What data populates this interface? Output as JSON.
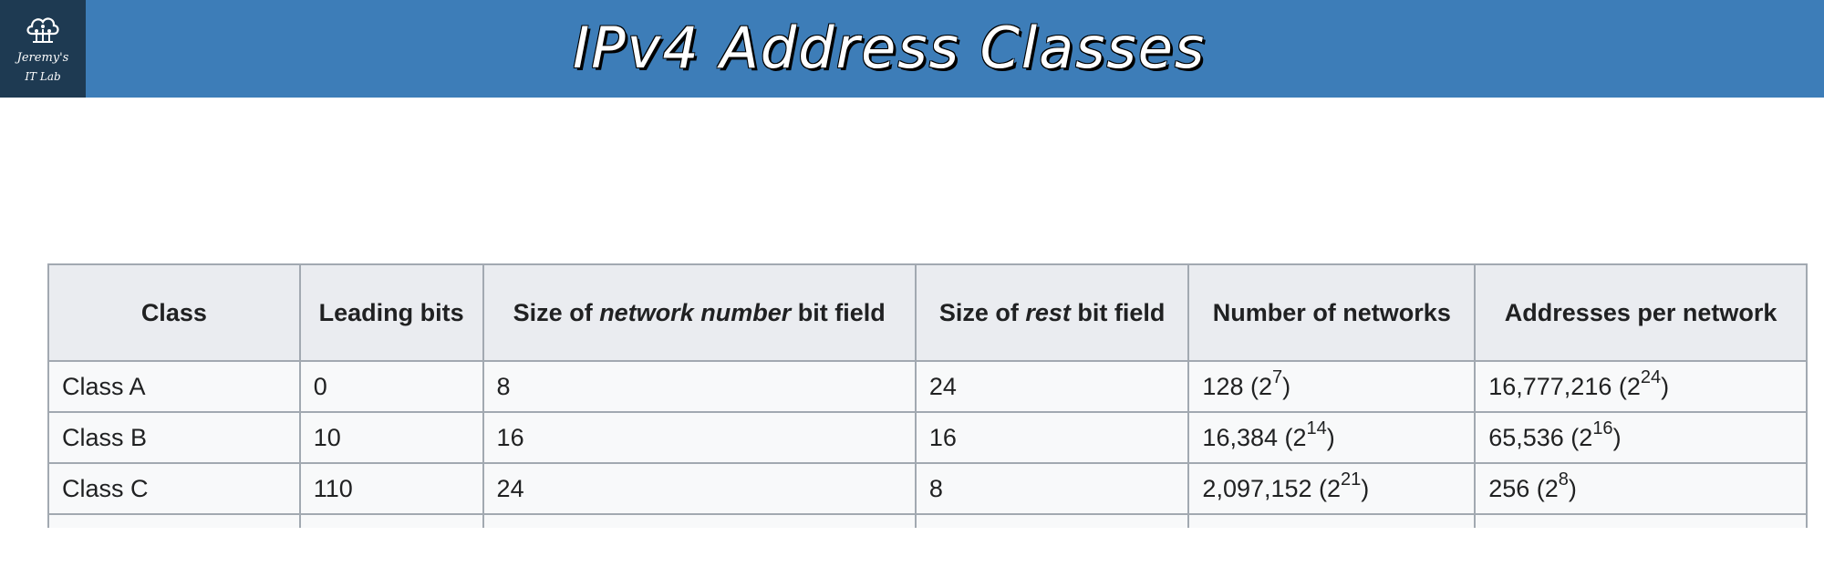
{
  "logo": {
    "line1": "Jeremy's",
    "line2": "IT Lab"
  },
  "title": "IPv4 Address Classes",
  "table": {
    "headers": [
      {
        "pre": "Class",
        "em": "",
        "post": ""
      },
      {
        "pre": "Leading bits",
        "em": "",
        "post": ""
      },
      {
        "pre": "Size of ",
        "em": "network number",
        "post": " bit field"
      },
      {
        "pre": "Size of ",
        "em": "rest",
        "post": " bit field"
      },
      {
        "pre": "Number of networks",
        "em": "",
        "post": ""
      },
      {
        "pre": "Addresses per network",
        "em": "",
        "post": ""
      }
    ],
    "rows": [
      {
        "class": "Class A",
        "leading_bits": "0",
        "network_bits": "8",
        "rest_bits": "24",
        "networks": {
          "value": "128 (2",
          "exp": "7",
          "close": ")"
        },
        "addresses": {
          "value": "16,777,216 (2",
          "exp": "24",
          "close": ")"
        }
      },
      {
        "class": "Class B",
        "leading_bits": "10",
        "network_bits": "16",
        "rest_bits": "16",
        "networks": {
          "value": "16,384 (2",
          "exp": "14",
          "close": ")"
        },
        "addresses": {
          "value": "65,536 (2",
          "exp": "16",
          "close": ")"
        }
      },
      {
        "class": "Class C",
        "leading_bits": "110",
        "network_bits": "24",
        "rest_bits": "8",
        "networks": {
          "value": "2,097,152 (2",
          "exp": "21",
          "close": ")"
        },
        "addresses": {
          "value": "256 (2",
          "exp": "8",
          "close": ")"
        }
      }
    ]
  },
  "colors": {
    "header_bar": "#3d7db8",
    "logo_bg": "#1e3a52",
    "table_header_bg": "#eaecf0",
    "table_cell_bg": "#f8f9fa",
    "table_border": "#a2a9b1"
  }
}
